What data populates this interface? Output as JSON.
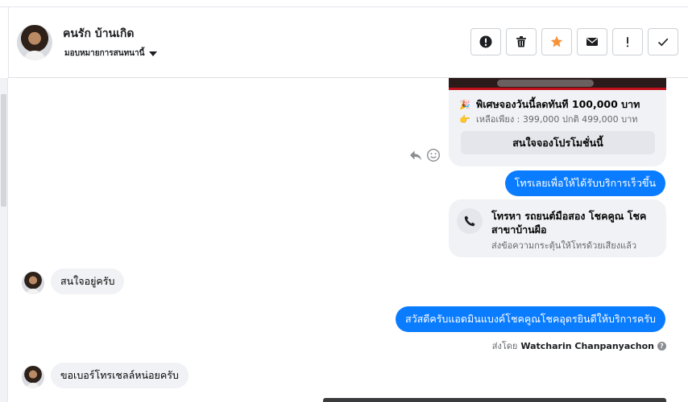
{
  "header": {
    "contact_name": "คนรัก บ้านเกิด",
    "assign_label": "มอบหมายการสนทนานี้",
    "actions": [
      {
        "name": "alert-icon",
        "label": "!"
      },
      {
        "name": "trash-icon",
        "label": ""
      },
      {
        "name": "star-icon",
        "label": ""
      },
      {
        "name": "envelope-icon",
        "label": ""
      },
      {
        "name": "exclamation-icon",
        "label": "!"
      },
      {
        "name": "check-icon",
        "label": ""
      }
    ],
    "star_color": "#f7923a"
  },
  "thread": {
    "promo": {
      "emoji_1": "🎉",
      "headline": "พิเศษจองวันนี้ลดทันที 100,000 บาท",
      "emoji_2": "👉",
      "price": "เหลือเพียง : 399,000  ปกติ 499,000 บาท",
      "button": "สนใจจองโปรโมชั่นนี้"
    },
    "messages": [
      {
        "direction": "out",
        "text": "โทรเลยเพื่อให้ได้รับบริการเร็วขึ้น"
      },
      {
        "direction": "out-call",
        "title": "โทรหา รถยนต์มือสอง โชคคูณ โชค สาขาบ้านผือ",
        "subtitle": "ส่งข้อความกระตุ้นให้โทรด้วยเสียงแล้ว"
      },
      {
        "direction": "in",
        "text": "สนใจอยู่ครับ"
      },
      {
        "direction": "out",
        "text": "สวัสดีครับแอดมินแบงค์โชคคูณโชคอุดรยินดีให้บริการครับ"
      },
      {
        "direction": "in",
        "text": "ขอเบอร์โทรเชลล์หน่อยครับ"
      }
    ],
    "sent_by_prefix": "ส่งโดย",
    "sent_by_name": "Watcharin Chanpanyachon",
    "help_glyph": "?"
  },
  "colors": {
    "outgoing_bubble": "#0a7cff",
    "incoming_bubble": "#f0f2f5"
  }
}
